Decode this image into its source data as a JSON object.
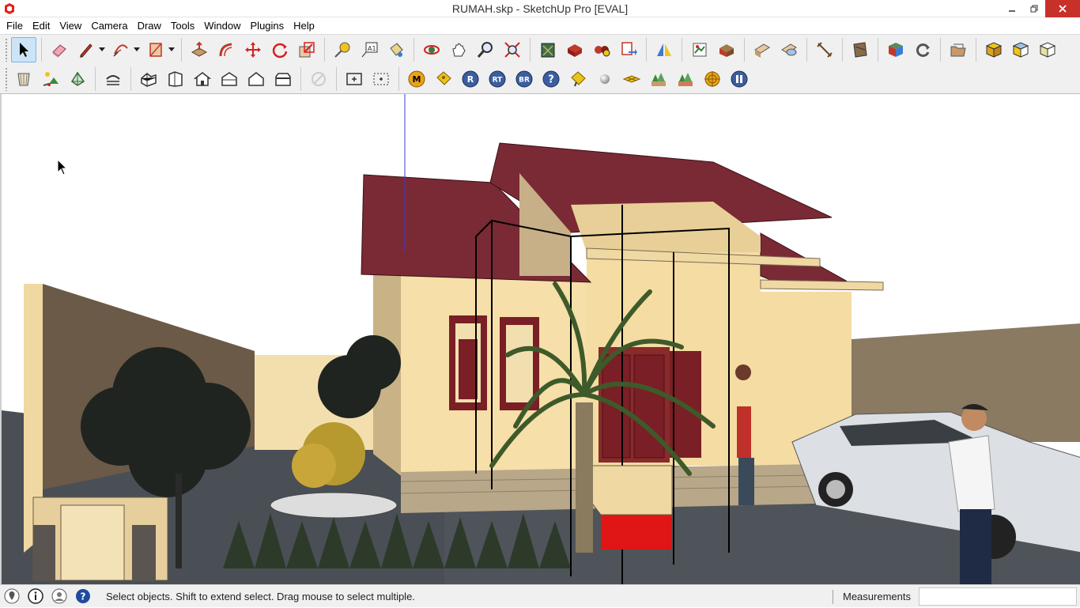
{
  "window": {
    "title": "RUMAH.skp - SketchUp Pro [EVAL]",
    "controls": [
      "minimize",
      "restore",
      "close"
    ]
  },
  "menu": {
    "items": [
      "File",
      "Edit",
      "View",
      "Camera",
      "Draw",
      "Tools",
      "Window",
      "Plugins",
      "Help"
    ]
  },
  "toolbar_row1": [
    "select-tool",
    "eraser-tool",
    "pencil-tool",
    "arc-tool",
    "shape-tool",
    "push-pull-tool",
    "follow-me-tool",
    "move-tool",
    "rotate-tool",
    "scale-tool",
    "tape-measure-tool",
    "text-tool",
    "paint-bucket-tool",
    "orbit-tool",
    "pan-tool",
    "zoom-tool",
    "zoom-extents-tool",
    "warehouse-icon",
    "share-model-icon",
    "components-icon",
    "send-layout-icon",
    "section-plane-tool",
    "add-location-icon",
    "toggle-terrain-icon",
    "photo-texture-icon",
    "match-photo-icon",
    "dimension-tool",
    "sandbox-icon",
    "solid-icon",
    "rotate-view-icon",
    "folder-icon",
    "iso-view",
    "top-view",
    "front-view"
  ],
  "toolbar_row2": [
    "xray-style",
    "shadow-toggle",
    "hidden-line-style",
    "walk-tool",
    "house-iso-view",
    "house-front-view",
    "house-top-view",
    "house-right-view",
    "house-back-view",
    "house-left-view",
    "disabled-tool",
    "zoom-window-tool",
    "zoom-select-tool",
    "render-m-icon",
    "render-tag-icon",
    "render-r-icon",
    "render-rt-icon",
    "render-br-icon",
    "help-icon",
    "material-tag-icon",
    "sphere-icon",
    "plane-icon",
    "landscape-icon",
    "landscape2-icon",
    "target-icon",
    "pause-icon"
  ],
  "toolbar_letters": {
    "m": "M",
    "r": "R",
    "rt": "RT",
    "br": "BR",
    "help": "?"
  },
  "status": {
    "hint": "Select objects. Shift to extend select. Drag mouse to select multiple.",
    "measurements_label": "Measurements",
    "measurements_value": ""
  },
  "colors": {
    "roof": "#7a2a35",
    "wall": "#f6dfa8",
    "window_frame": "#7a1f26",
    "door": "#8a2a2a",
    "ground": "#4a4f55",
    "sky": "#ffffff",
    "close_button": "#c7312a"
  }
}
